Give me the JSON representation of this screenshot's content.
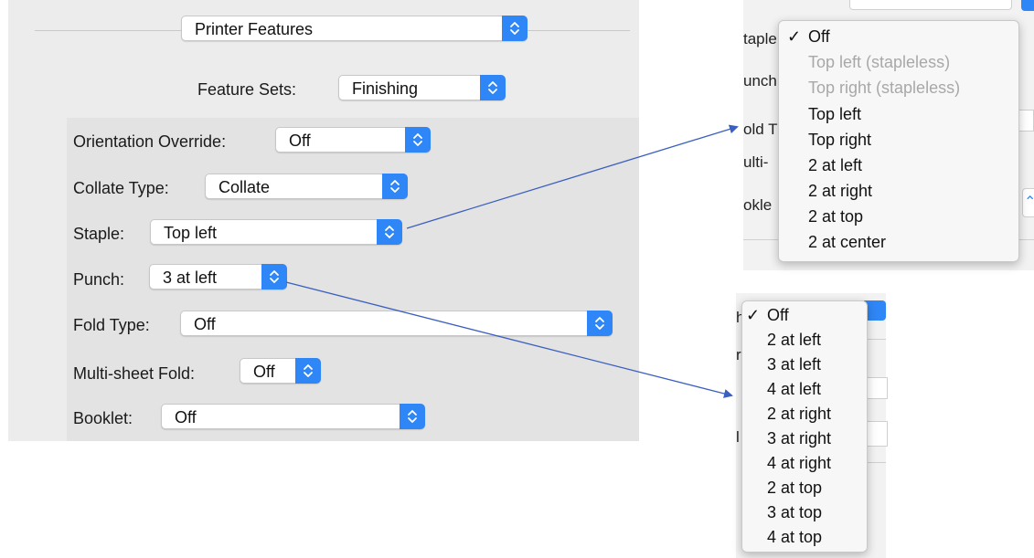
{
  "panel": {
    "header_select": "Printer Features",
    "feature_sets": {
      "label": "Feature Sets:",
      "value": "Finishing"
    },
    "rows": [
      {
        "label": "Orientation Override:",
        "value": "Off"
      },
      {
        "label": "Collate Type:",
        "value": "Collate"
      },
      {
        "label": "Staple:",
        "value": "Top left"
      },
      {
        "label": "Punch:",
        "value": "3 at left"
      },
      {
        "label": "Fold Type:",
        "value": "Off"
      },
      {
        "label": "Multi-sheet Fold:",
        "value": "Off"
      },
      {
        "label": "Booklet:",
        "value": "Off"
      }
    ]
  },
  "staple_menu": {
    "background_labels": [
      "taple",
      "unch",
      "old T",
      "ulti-",
      "okle"
    ],
    "checkmark": "✓",
    "items": [
      {
        "label": "Off",
        "checked": true,
        "enabled": true
      },
      {
        "label": "Top left (stapleless)",
        "checked": false,
        "enabled": false
      },
      {
        "label": "Top right (stapleless)",
        "checked": false,
        "enabled": false
      },
      {
        "label": "Top left",
        "checked": false,
        "enabled": true
      },
      {
        "label": "Top right",
        "checked": false,
        "enabled": true
      },
      {
        "label": "2 at left",
        "checked": false,
        "enabled": true
      },
      {
        "label": "2 at right",
        "checked": false,
        "enabled": true
      },
      {
        "label": "2 at top",
        "checked": false,
        "enabled": true
      },
      {
        "label": "2 at center",
        "checked": false,
        "enabled": true
      }
    ]
  },
  "punch_menu": {
    "background_labels": [
      "h",
      "r",
      "l"
    ],
    "checkmark": "✓",
    "items": [
      {
        "label": "Off",
        "checked": true
      },
      {
        "label": "2 at left",
        "checked": false
      },
      {
        "label": "3 at left",
        "checked": false
      },
      {
        "label": "4 at left",
        "checked": false
      },
      {
        "label": "2 at right",
        "checked": false
      },
      {
        "label": "3 at right",
        "checked": false
      },
      {
        "label": "4 at right",
        "checked": false
      },
      {
        "label": "2 at top",
        "checked": false
      },
      {
        "label": "3 at top",
        "checked": false
      },
      {
        "label": "4 at top",
        "checked": false
      }
    ]
  },
  "colors": {
    "accent": "#2f86f6",
    "arrow_line": "#3b5fc0",
    "disabled_text": "#a8a8a8"
  }
}
